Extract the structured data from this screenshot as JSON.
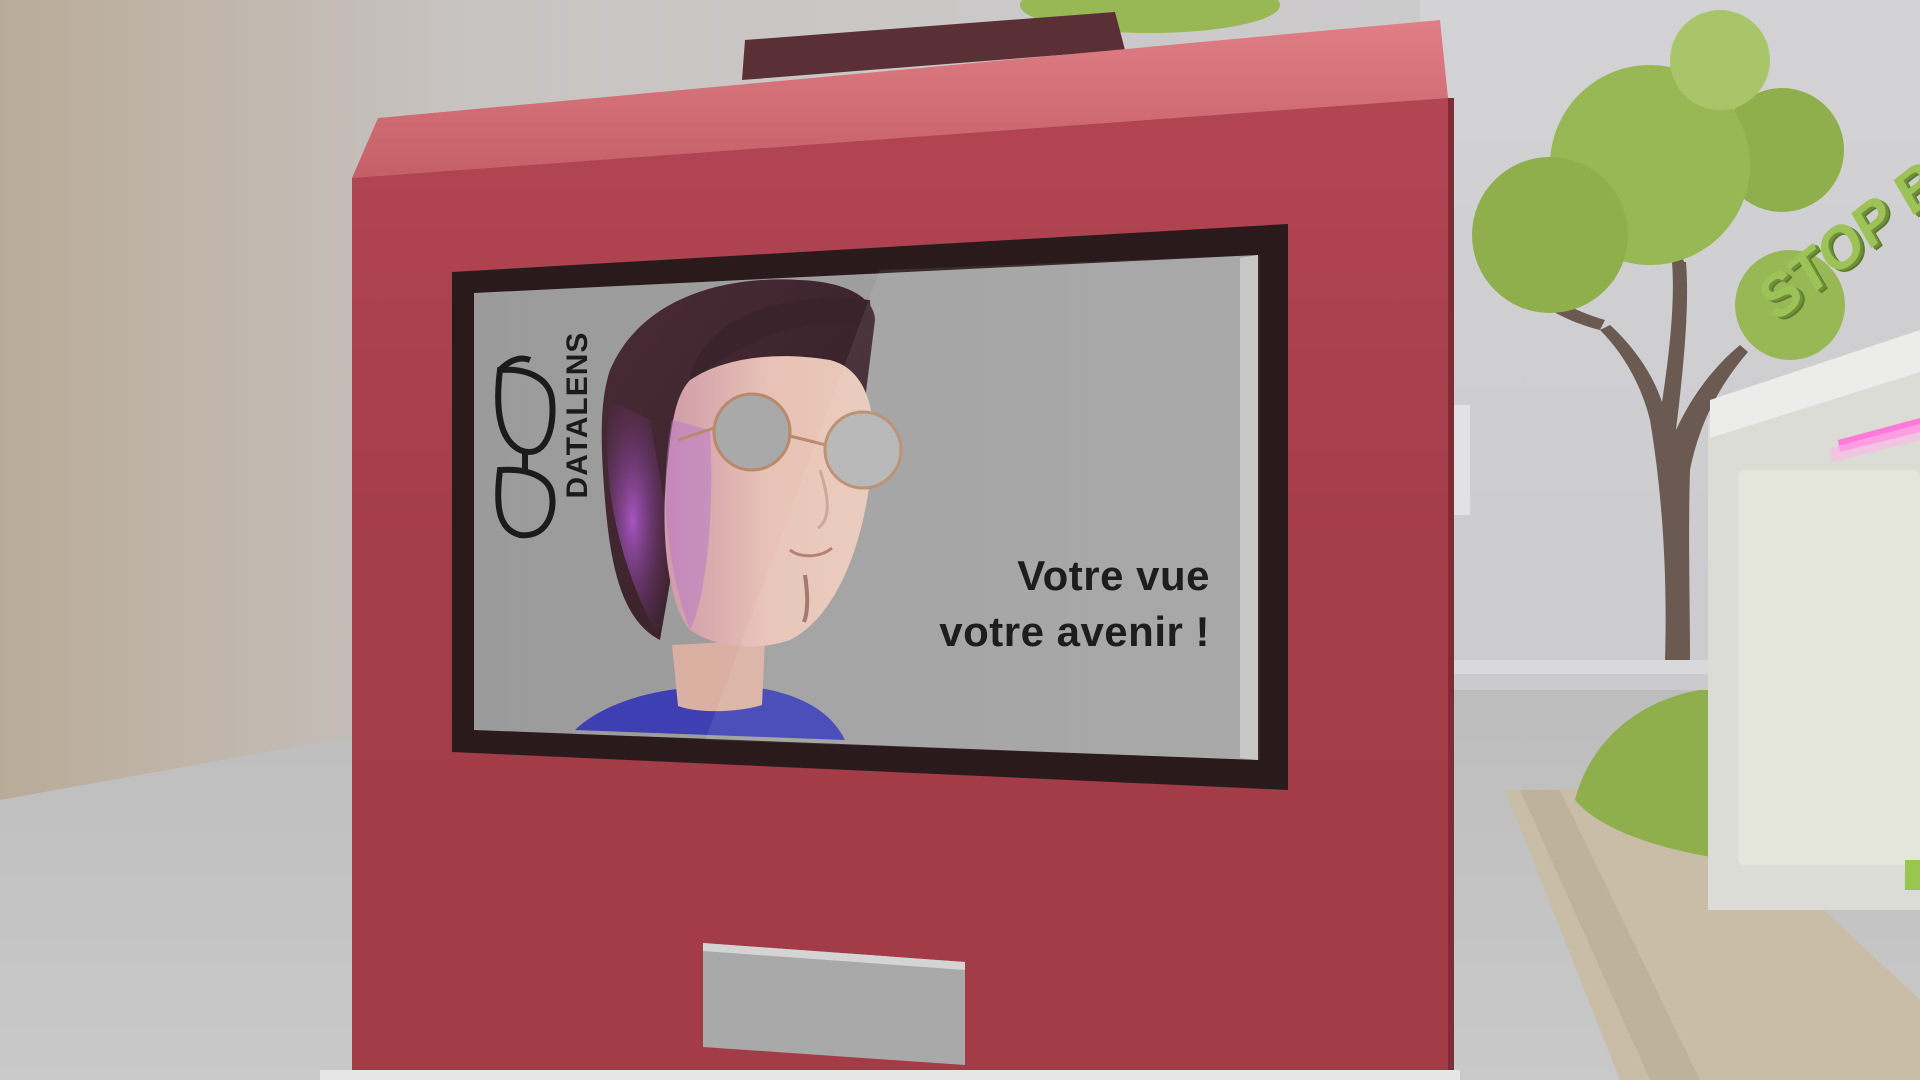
{
  "scene": {
    "billboard": {
      "brand": "DATALENS",
      "slogan_line1": "Votre vue",
      "slogan_line2": "votre avenir !"
    },
    "bus_stop": {
      "sign_text": "STOP BUS"
    }
  },
  "colors": {
    "kiosk_red": "#a23a46",
    "kiosk_top": "#d9737b",
    "poster_grey": "#9b9b9b",
    "foliage_green": "#98b856",
    "trunk_brown": "#6a5a52",
    "neon_pink": "#ff7ad8"
  }
}
